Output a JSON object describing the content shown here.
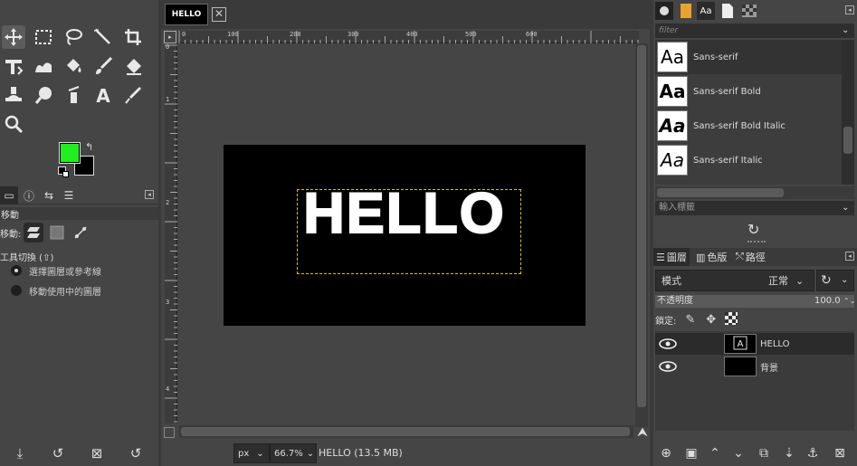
{
  "toolbox": {
    "tools": [
      "move-tool",
      "rect-select-tool",
      "lasso-select-tool",
      "fuzzy-select-tool",
      "crop-tool",
      "unified-transform-tool",
      "warp-tool",
      "bucket-fill-tool",
      "paintbrush-tool",
      "eraser-tool",
      "clone-tool",
      "smudge-tool",
      "dodge-tool",
      "text-tool",
      "color-picker-tool",
      "zoom-tool"
    ],
    "fg_color": "#22ee22",
    "bg_color": "#000000",
    "options_title": "移動",
    "move_label": "移動:",
    "tool_toggle_label": "工具切換 (⇧)",
    "radio1": "選擇圖層或參考線",
    "radio2": "移動使用中的圖層"
  },
  "image_window": {
    "tab_label": "HELLO",
    "canvas_text": "HELLO",
    "ruler_top_labels": [
      "0",
      "100",
      "200",
      "300",
      "400",
      "500",
      "600"
    ],
    "ruler_left_labels": [
      "0",
      "1",
      "2",
      "3",
      "4"
    ],
    "unit": "px",
    "zoom": "66.7%",
    "status": "HELLO (13.5 MB)"
  },
  "dock": {
    "filter_placeholder": "filter",
    "fonts": [
      {
        "preview": "Aa",
        "name": "Sans-serif"
      },
      {
        "preview": "Aa",
        "name": "Sans-serif Bold"
      },
      {
        "preview": "Aa",
        "name": "Sans-serif Bold Italic"
      },
      {
        "preview": "Aa",
        "name": "Sans-serif Italic"
      }
    ],
    "tag_input": "輸入標籤",
    "layers_tab": "圖層",
    "channels_tab": "色版",
    "paths_tab": "路徑",
    "mode_label": "模式",
    "mode_value": "正常",
    "opacity_label": "不透明度",
    "opacity_value": "100.0",
    "lock_label": "鎖定:",
    "layers": [
      {
        "name": "HELLO"
      },
      {
        "name": "背景"
      }
    ]
  }
}
